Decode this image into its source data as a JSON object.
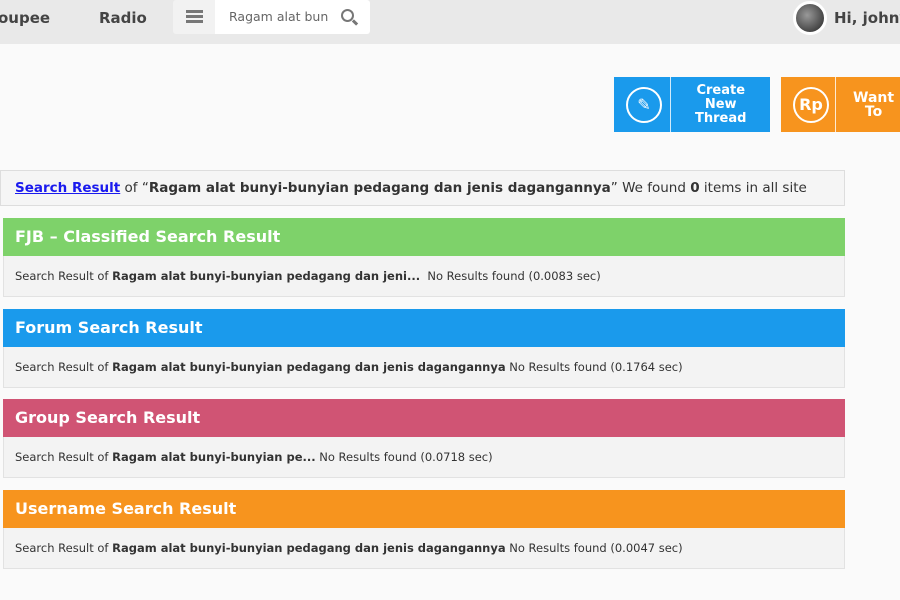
{
  "nav": {
    "items": [
      "oupee",
      "Radio"
    ],
    "search_value": "Ragam alat bun",
    "greeting": "Hi, johny"
  },
  "actions": {
    "create_thread": [
      "Create New",
      "Thread"
    ],
    "want_to": "Want To",
    "rp_icon": "Rp"
  },
  "summary": {
    "link": "Search Result",
    "of": " of “",
    "query": "Ragam alat bunyi-bunyian pedagang dan jenis dagangannya",
    "found_pre": "” We found ",
    "count": "0",
    "found_post": " items in all site"
  },
  "colors": {
    "fjb": "#7ed26a",
    "forum": "#1a9aec",
    "group": "#d05474",
    "username": "#f7941e"
  },
  "blocks": [
    {
      "title": "FJB – Classified Search Result",
      "prefix": "Search Result of ",
      "query": "Ragam alat bunyi-bunyian pedagang dan jeni...",
      "status": "  No Results found (0.0083 sec)"
    },
    {
      "title": "Forum Search Result",
      "prefix": "Search Result of ",
      "query": "Ragam alat bunyi-bunyian pedagang dan jenis dagangannya",
      "status": " No Results found (0.1764 sec)"
    },
    {
      "title": "Group Search Result",
      "prefix": "Search Result of ",
      "query": "Ragam alat bunyi-bunyian pe...",
      "status": " No Results found (0.0718 sec)"
    },
    {
      "title": "Username Search Result",
      "prefix": "Search Result of ",
      "query": "Ragam alat bunyi-bunyian pedagang dan jenis dagangannya",
      "status": " No Results found (0.0047 sec)"
    }
  ]
}
